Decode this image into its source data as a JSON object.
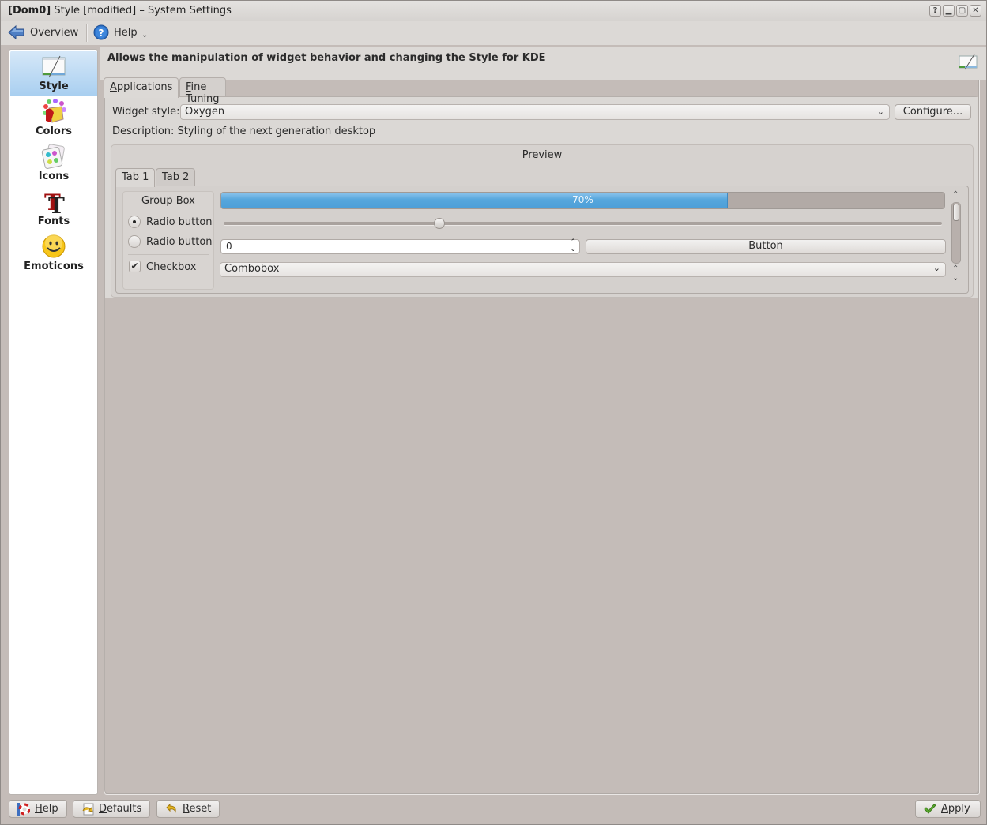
{
  "window": {
    "title_prefix": "[Dom0]",
    "title": "Style [modified] – System Settings",
    "controls": {
      "help": "?",
      "minimize": "_",
      "maximize": "□",
      "close": "✕"
    }
  },
  "toolbar": {
    "overview_label": "Overview",
    "help_label": "Help",
    "more_chevron": "⌄"
  },
  "sidebar": {
    "items": [
      {
        "label": "Style",
        "icon": "style-icon",
        "selected": true
      },
      {
        "label": "Colors",
        "icon": "colors-icon",
        "selected": false
      },
      {
        "label": "Icons",
        "icon": "icons-icon",
        "selected": false
      },
      {
        "label": "Fonts",
        "icon": "fonts-icon",
        "selected": false
      },
      {
        "label": "Emoticons",
        "icon": "emoticons-icon",
        "selected": false
      }
    ]
  },
  "page": {
    "description": "Allows the manipulation of widget behavior and changing the Style for KDE",
    "tabs": [
      {
        "label": "Applications",
        "mnemonic": "A",
        "rest": "pplications",
        "active": true
      },
      {
        "label": "Fine Tuning",
        "mnemonic": "F",
        "rest": "ine Tuning",
        "active": false
      }
    ],
    "widget_style_label": "Widget style:",
    "widget_style_value": "Oxygen",
    "configure_label": "Configure...",
    "style_description": "Description: Styling of the next generation desktop"
  },
  "preview": {
    "title": "Preview",
    "tabs": [
      {
        "label": "Tab 1",
        "active": true
      },
      {
        "label": "Tab 2",
        "active": false
      }
    ],
    "group_box_title": "Group Box",
    "radio1_label": "Radio button",
    "radio1_checked": true,
    "radio2_label": "Radio button",
    "radio2_checked": false,
    "checkbox_label": "Checkbox",
    "checkbox_checked": true,
    "progress_percent": 70,
    "progress_text": "70%",
    "slider_fraction": 0.3,
    "spinbox_value": "0",
    "button_label": "Button",
    "combobox_value": "Combobox",
    "scroll_fraction": 0.0
  },
  "footer": {
    "help_mn": "H",
    "help_rest": "elp",
    "defaults_mn": "D",
    "defaults_rest": "efaults",
    "reset_mn": "R",
    "reset_rest": "eset",
    "apply_mn": "A",
    "apply_rest": "pply"
  },
  "colors": {
    "selection": "#a9cff0",
    "progress": "#56a6dc",
    "window_bg": "#c4bcb8"
  }
}
